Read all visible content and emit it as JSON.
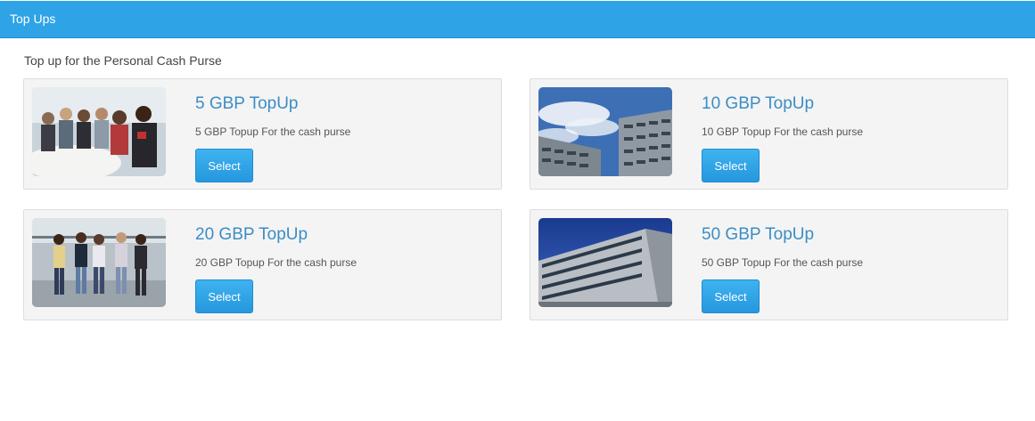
{
  "header": {
    "title": "Top Ups"
  },
  "page": {
    "subtitle": "Top up for the Personal Cash Purse"
  },
  "cards": [
    {
      "title": "5 GBP TopUp",
      "description": "5 GBP Topup For the cash purse",
      "button_label": "Select",
      "image": "students-group-photo"
    },
    {
      "title": "10 GBP TopUp",
      "description": "10 GBP Topup For the cash purse",
      "button_label": "Select",
      "image": "campus-building-photo"
    },
    {
      "title": "20 GBP TopUp",
      "description": "20 GBP Topup For the cash purse",
      "button_label": "Select",
      "image": "students-walking-photo"
    },
    {
      "title": "50 GBP TopUp",
      "description": "50 GBP Topup For the cash purse",
      "button_label": "Select",
      "image": "modern-building-photo"
    }
  ],
  "colors": {
    "header_bg": "#2ea3e6",
    "accent": "#3b8dc5",
    "button": "#2a9fe4"
  }
}
